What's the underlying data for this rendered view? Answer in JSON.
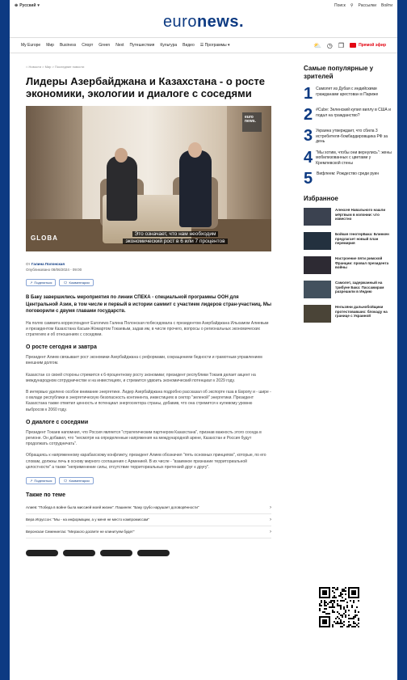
{
  "topbar": {
    "language": "Русский",
    "search": "Поиск",
    "newsletter": "Рассылки",
    "signin": "Войти"
  },
  "logo": {
    "prefix": "euro",
    "suffix": "news."
  },
  "nav": {
    "items": [
      "My Europe",
      "Мир",
      "Business",
      "Спорт",
      "Green",
      "Next",
      "Путешествия",
      "Культура",
      "Видео"
    ],
    "programs": "Программы",
    "live": "Прямой эфир"
  },
  "article": {
    "breadcrumb": "Новости > Мир > Последние новости",
    "title": "Лидеры Азербайджана и Казахстана - о росте экономики, экологии и диалоге с соседями",
    "hero": {
      "badge": "euro news.",
      "program": "GLOBA",
      "caption_line1": "Это означает, что нам необходим",
      "caption_line2": "экономический рост в 6 или 7 процентов"
    },
    "author": "Галина Полонская",
    "author_prefix": "От",
    "published": "Опубликовано 08/06/2024 - 09:00",
    "share_label": "Поделиться",
    "comments_label": "Комментарии",
    "lead": "В Баку завершились мероприятия по линии СПЕКА - специальной программы ООН для Центральной Азии, в том числе и первый в истории саммит с участием лидеров стран-участниц. Мы поговорили с двумя главами государств.",
    "p1": "На полях саммита корреспондент Euronews Галина Полонская побеседовала с президентом Азербайджана Ильхамом Алиевым и президентом Казахстана Касым-Жомартом Токаевым, задав им, в числе прочего, вопросы о региональных экономических стратегиях и об отношениях с соседями.",
    "h_econ": "О росте сегодня и завтра",
    "p2": "Президент Алиев связывает рост экономики Азербайджана с реформами, сокращением бедности и грамотным управлением внешним долгом.",
    "p3": "Казахстан со своей стороны стремится к 6-процентному росту экономики; президент республики Токаев делает акцент на международном сотрудничестве и на инвестициях, и стремится удвоить экономический потенциал к 2029 году.",
    "p4": "В интервью уделено особое внимание энергетике. Лидер Азербайджана подробно рассказал об экспорте газа в Европу и - шире - о вкладе республики в энергетическую безопасность континента, инвестициях в сектор \"зеленой\" энергетики. Президент Казахстана также отметил ценность и потенциал энергосектора страны, добавив, что она стремится к нулевому уровню выбросов к 2060 году.",
    "h_dialog": "О диалоге с соседями",
    "p5": "Президент Токаев напомнил, что Россия является \"стратегическим партнером Казахстана\", признав важность этого соседа в регионе. Он добавил, что \"несмотря на определенные напряжения на международной арене, Казахстан и Россия будут продолжать сотрудничать\".",
    "p6": "Обращаясь к напряженному карабахскому конфликту, президент Алиев обозначил \"пять основных принципов\", которые, по его словам, должны лечь в основу мирного соглашения с Арменией. В их числе - \"взаимное признание территориальной целостности\" а также \"неприменение силы, отсутствие территориальных претензий друг к другу\".",
    "also_title": "Также по теме",
    "related": [
      "Алиев: \"Победа в войне была миссией моей жизни\". Пашинян: \"Баку грубо нарушает договорённости\"",
      "Вера Игруссон: \"Мы - на информации, а у меня не место компромиссам\"",
      "Веронскае Семенинтах: \"Мерзкого досвете не клинитуем будет\""
    ]
  },
  "sidebar": {
    "popular_title": "Самые популярные у зрителей",
    "popular": [
      {
        "num": "1",
        "text": "Самолет из Дубая с индийскими гражданами арестован в Париже"
      },
      {
        "num": "2",
        "text": "#Cube: Зеленский купил виллу в США и подал на гражданство?"
      },
      {
        "num": "3",
        "text": "Украина утверждает, что сбила 3 истребителя-бомбардировщика РФ за день"
      },
      {
        "num": "4",
        "text": "\"Мы хотим, чтобы они вернулись\": жены мобилизованных с цветами у Кремлевской стены"
      },
      {
        "num": "5",
        "text": "Вифлеем: Рождество среди руин"
      }
    ],
    "picks_title": "Избранное",
    "picks": [
      {
        "text": "Алексея Навального нашли мёртвым в колонии: что известно",
        "color": "#3b4250"
      },
      {
        "text": "Бойкая генотерБака: Блинкен предлагает новый план перемирия",
        "color": "#23313f"
      },
      {
        "text": "Настроение пяти римской Франции: провал президента войны",
        "color": "#2d2a33"
      },
      {
        "text": "Самолет, задержанный на трибуне Бака: Пассажирам разрешили в Индию",
        "color": "#43515e"
      },
      {
        "text": "Нельзяни дальнобойщики протестовавших: блокаду на границе с Украиной",
        "color": "#4a4437"
      }
    ]
  },
  "colors": {
    "brand": "#0d3a82",
    "live": "#e30613",
    "frame": "#0d3a82"
  }
}
